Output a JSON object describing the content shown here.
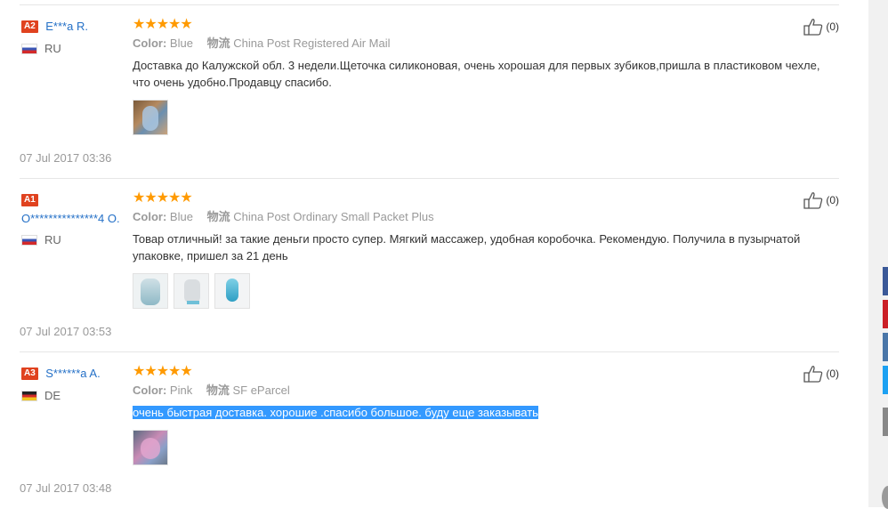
{
  "reviews": [
    {
      "badge": "A2",
      "name": "E***a R.",
      "country": "RU",
      "flag": "ru",
      "stars": "★★★★★",
      "color_label": "Color:",
      "color_value": "Blue",
      "shipping_label": "物流",
      "shipping_value": "China Post Registered Air Mail",
      "text": "Доставка до Калужской обл. 3 недели.Щеточка силиконовая, очень хорошая для первых зубиков,пришла в пластиковом чехле, что очень удобно.Продавцу спасибо.",
      "images": [
        "photo-brush-case"
      ],
      "date": "07 Jul 2017 03:36",
      "helpful": "(0)"
    },
    {
      "badge": "A1",
      "name": "O***************4 O.",
      "country": "RU",
      "flag": "ru",
      "stars": "★★★★★",
      "color_label": "Color:",
      "color_value": "Blue",
      "shipping_label": "物流",
      "shipping_value": "China Post Ordinary Small Packet Plus",
      "text": "Товар отличный! за такие деньги просто супер. Мягкий массажер, удобная коробочка. Рекомендую. Получила в пузырчатой упаковке, пришел за 21 день",
      "images": [
        "photo-case-open",
        "photo-case-clear",
        "photo-brush-blue"
      ],
      "date": "07 Jul 2017 03:53",
      "helpful": "(0)"
    },
    {
      "badge": "A3",
      "name": "S******a A.",
      "country": "DE",
      "flag": "de",
      "stars": "★★★★★",
      "color_label": "Color:",
      "color_value": "Pink",
      "shipping_label": "物流",
      "shipping_value": "SF eParcel",
      "text": "очень быстрая доставка. хорошие .спасибо большое. буду еще заказывать",
      "images": [
        "photo-pink-case"
      ],
      "date": "07 Jul 2017 03:48",
      "helpful": "(0)"
    }
  ],
  "side_colors": [
    "#3b5998",
    "#cb2027",
    "#4a76a8",
    "#1da1f2",
    "#888888"
  ]
}
